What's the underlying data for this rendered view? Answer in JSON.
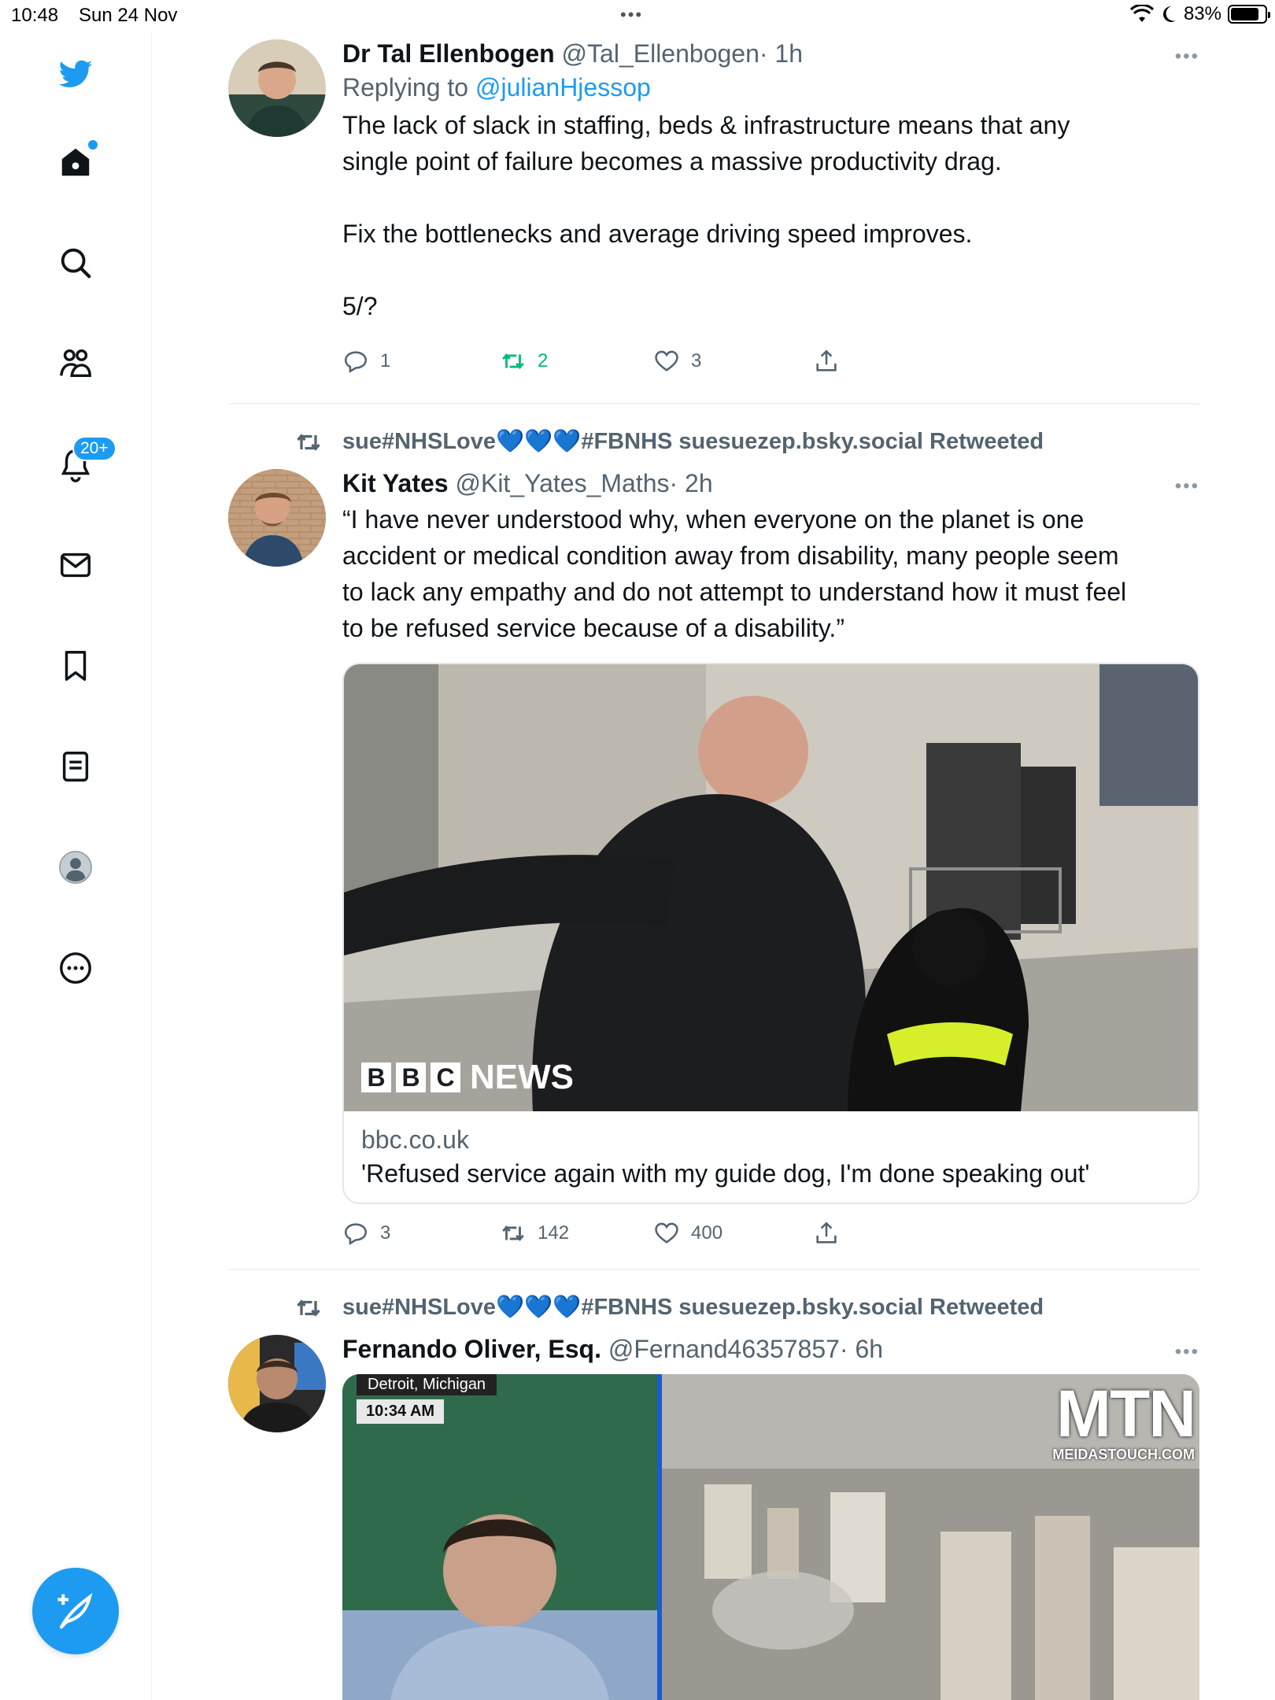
{
  "status_bar": {
    "time": "10:48",
    "date": "Sun 24 Nov",
    "battery": "83%",
    "battery_level": 0.83
  },
  "sidebar": {
    "items": [
      {
        "name": "twitter-logo"
      },
      {
        "name": "home"
      },
      {
        "name": "explore"
      },
      {
        "name": "communities"
      },
      {
        "name": "notifications"
      },
      {
        "name": "messages"
      },
      {
        "name": "bookmarks"
      },
      {
        "name": "lists"
      },
      {
        "name": "profile"
      },
      {
        "name": "more"
      }
    ],
    "notifications_badge": "20+"
  },
  "tweets": [
    {
      "name": "Dr Tal Ellenbogen",
      "handle": "@Tal_Ellenbogen",
      "time": "· 1h",
      "replying_prefix": "Replying to ",
      "replying_handle": "@julianHjessop",
      "text_lines": [
        "The lack of slack in staffing, beds & infrastructure means that any",
        "single point of failure becomes a massive productivity drag.",
        "",
        "Fix the bottlenecks and average driving speed improves.",
        "",
        "5/?"
      ],
      "replies": "1",
      "retweets": "2",
      "likes": "3"
    },
    {
      "retweeted_by_prefix": "sue#NHSLove",
      "retweeted_by_hearts": "💙💙💙",
      "retweeted_by_suffix": "#FBNHS suesuezep.bsky.social Retweeted",
      "name": "Kit Yates",
      "handle": "@Kit_Yates_Maths",
      "time": "· 2h",
      "text_lines": [
        "“I have never understood why, when everyone on the planet is one",
        "accident or medical condition away from disability, many people seem",
        "to lack any empathy and do not attempt to understand how it must feel",
        "to be refused service because of a disability.”"
      ],
      "card": {
        "image_watermark": "NEWS",
        "bbc_letters": [
          "B",
          "B",
          "C"
        ],
        "domain": "bbc.co.uk",
        "title": "'Refused service again with my guide dog, I'm done speaking out'"
      },
      "replies": "3",
      "retweets": "142",
      "likes": "400"
    },
    {
      "retweeted_by_prefix": "sue#NHSLove",
      "retweeted_by_hearts": "💙💙💙",
      "retweeted_by_suffix": "#FBNHS suesuezep.bsky.social Retweeted",
      "name": "Fernando Oliver, Esq.",
      "handle": "@Fernand46357857",
      "time": "· 6h",
      "media": {
        "location": "Detroit, Michigan",
        "clock": "10:34 AM",
        "logo": "MTN",
        "logo_sub": "MEIDASTOUCH.COM"
      }
    }
  ],
  "colors": {
    "accent": "#1d9bf0",
    "retweet_green": "#00ba7c",
    "secondary_text": "#536471"
  }
}
